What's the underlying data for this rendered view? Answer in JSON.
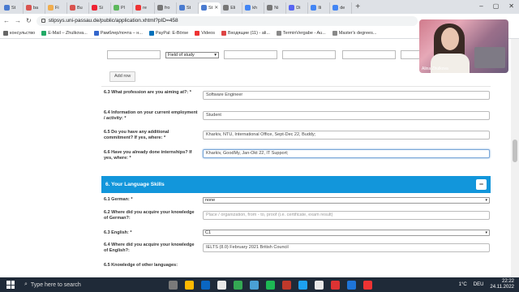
{
  "browser": {
    "tabs": [
      {
        "label": "St",
        "color": "#4a7bd0"
      },
      {
        "label": "ba",
        "color": "#d9534f"
      },
      {
        "label": "Fi",
        "color": "#f0ad4e"
      },
      {
        "label": "Bu",
        "color": "#d9534f"
      },
      {
        "label": "Si",
        "color": "#e23"
      },
      {
        "label": "Pl",
        "color": "#5cb85c"
      },
      {
        "label": "re",
        "color": "#e33"
      },
      {
        "label": "fro",
        "color": "#777"
      },
      {
        "label": "St",
        "color": "#4a7bd0"
      },
      {
        "label": "St",
        "color": "#4a7bd0",
        "active": true
      },
      {
        "label": "Eli",
        "color": "#777"
      },
      {
        "label": "kh",
        "color": "#4285f4"
      },
      {
        "label": "Ni",
        "color": "#777"
      },
      {
        "label": "Di",
        "color": "#5865f2"
      },
      {
        "label": "Ili",
        "color": "#4285f4"
      },
      {
        "label": "de",
        "color": "#4285f4"
      }
    ],
    "address": "stipsys.uni-passau.de/public/application.xhtml?pID=458",
    "bookmarks": [
      {
        "label": "консульство",
        "color": "#666"
      },
      {
        "label": "E-Mail – Zhulkova...",
        "color": "#2a6"
      },
      {
        "label": "Рамблер/почта – н...",
        "color": "#36c"
      },
      {
        "label": "PayPal: E-Börse",
        "color": "#0070ba"
      },
      {
        "label": "Videos",
        "color": "#e33"
      },
      {
        "label": "Входящие (11) - ali...",
        "color": "#d44"
      },
      {
        "label": "TerminVergabe - Au...",
        "color": "#888"
      },
      {
        "label": "Master's degrees...",
        "color": "#888"
      }
    ]
  },
  "form": {
    "top_select": "Field of study",
    "add_row_label": "Add row",
    "q63_label": "6.3 What profession are you aiming at?: *",
    "q63_value": "Software Engineer",
    "q64_label": "6.4 Information on your current employment / activity: *",
    "q64_value": "Student",
    "q65_label": "6.5 Do you have any additional commitment? If yes, where: *",
    "q65_value": "Kharkiv, NTU, International Office, Sept-Dec 22, Buddy;",
    "q66_label": "6.6 Have you already done internships? If yes, where: *",
    "q66_value": "Kharkiv, GoodMy, Jan-Okt 22, IT Support;",
    "section_title": "6. Your Language Skills",
    "section_toggle": "−",
    "l61_label": "6.1 German: *",
    "l61_value": "none",
    "l62_label": "6.2 Where did you acquire your knowledge of German?:",
    "l62_placeholder": "Place / organization, from - to, proof (i.e. certificate, exam result)",
    "l63_label": "6.3 English: *",
    "l63_value": "C1",
    "l64_label": "6.4 Where did you acquire your knowledge of English?:",
    "l64_value": "IELTS (8.0) February 2021 British Council",
    "l65_label": "6.5 Knowledge of other languages:"
  },
  "webcam": {
    "name": "Alina Zhulkova"
  },
  "taskbar": {
    "search_placeholder": "Type here to search",
    "weather": "1°C",
    "language": "DEU",
    "time": "22:22",
    "date": "24.11.2022",
    "icon_colors": [
      "#7a7a7a",
      "#ffb900",
      "#0a66c2",
      "#e8e8e8",
      "#34a853",
      "#4aa0d5",
      "#1db954",
      "#c0392b",
      "#1da1f2",
      "#e8e8e8",
      "#d33",
      "#1e74d8",
      "#e33"
    ]
  }
}
